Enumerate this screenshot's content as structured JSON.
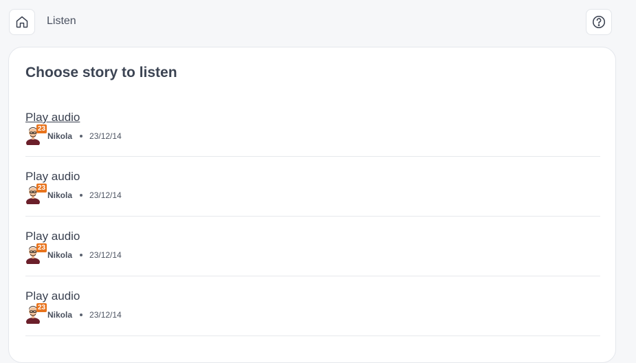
{
  "header": {
    "breadcrumb": "Listen",
    "home_icon": "home-icon",
    "help_icon": "help-circle-icon"
  },
  "main": {
    "title": "Choose story to listen",
    "stories": [
      {
        "play_label": "Play audio",
        "author": "Nikola",
        "badge": "23",
        "date": "23/12/14"
      },
      {
        "play_label": "Play audio",
        "author": "Nikola",
        "badge": "23",
        "date": "23/12/14"
      },
      {
        "play_label": "Play audio",
        "author": "Nikola",
        "badge": "23",
        "date": "23/12/14"
      },
      {
        "play_label": "Play audio",
        "author": "Nikola",
        "badge": "23",
        "date": "23/12/14"
      }
    ]
  },
  "colors": {
    "badge": "#e8731c",
    "background": "#f6f7f9",
    "card": "#ffffff"
  }
}
